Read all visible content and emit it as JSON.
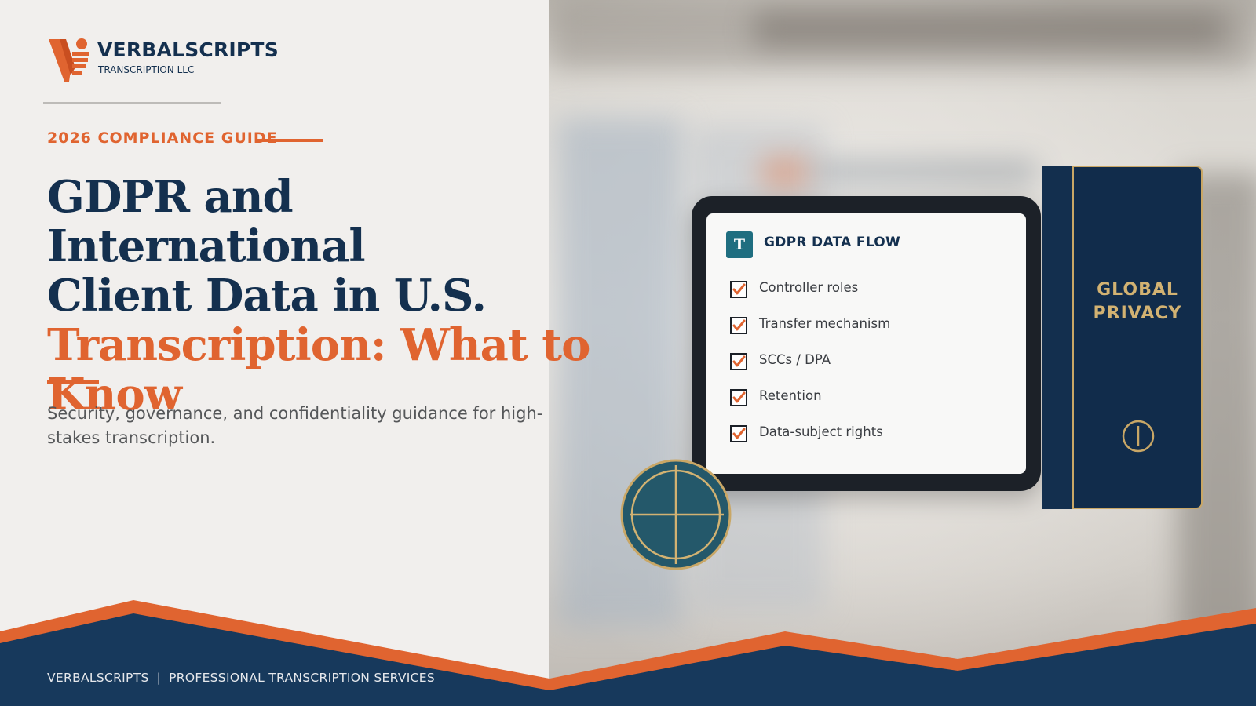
{
  "brand": {
    "name": "VERBALSCRIPTS",
    "subname": "TRANSCRIPTION LLC"
  },
  "hero": {
    "eyebrow": "2026 COMPLIANCE GUIDE",
    "headline_line1": "GDPR and International",
    "headline_line2": "Client Data in U.S.",
    "headline_accent": "Transcription: What to Know",
    "subtitle": "Security, governance, and confidentiality guidance for high-stakes transcription."
  },
  "tablet": {
    "logo_letter": "T",
    "title": "GDPR DATA FLOW",
    "checklist": [
      "Controller roles",
      "Transfer mechanism",
      "SCCs / DPA",
      "Retention",
      "Data-subject rights"
    ]
  },
  "passport": {
    "title_line1": "GLOBAL",
    "title_line2": "PRIVACY"
  },
  "footer": {
    "left": "VERBALSCRIPTS",
    "separator": "|",
    "right": "PROFESSIONAL TRANSCRIPTION SERVICES"
  },
  "colors": {
    "navy": "#14304f",
    "orange": "#e06430",
    "gold": "#c9a766",
    "teal": "#1f6e80",
    "background": "#f1efed"
  },
  "icons": [
    "brand-logo-icon",
    "checkbox-checked-icon",
    "passport-emblem-icon",
    "globe-icon"
  ]
}
